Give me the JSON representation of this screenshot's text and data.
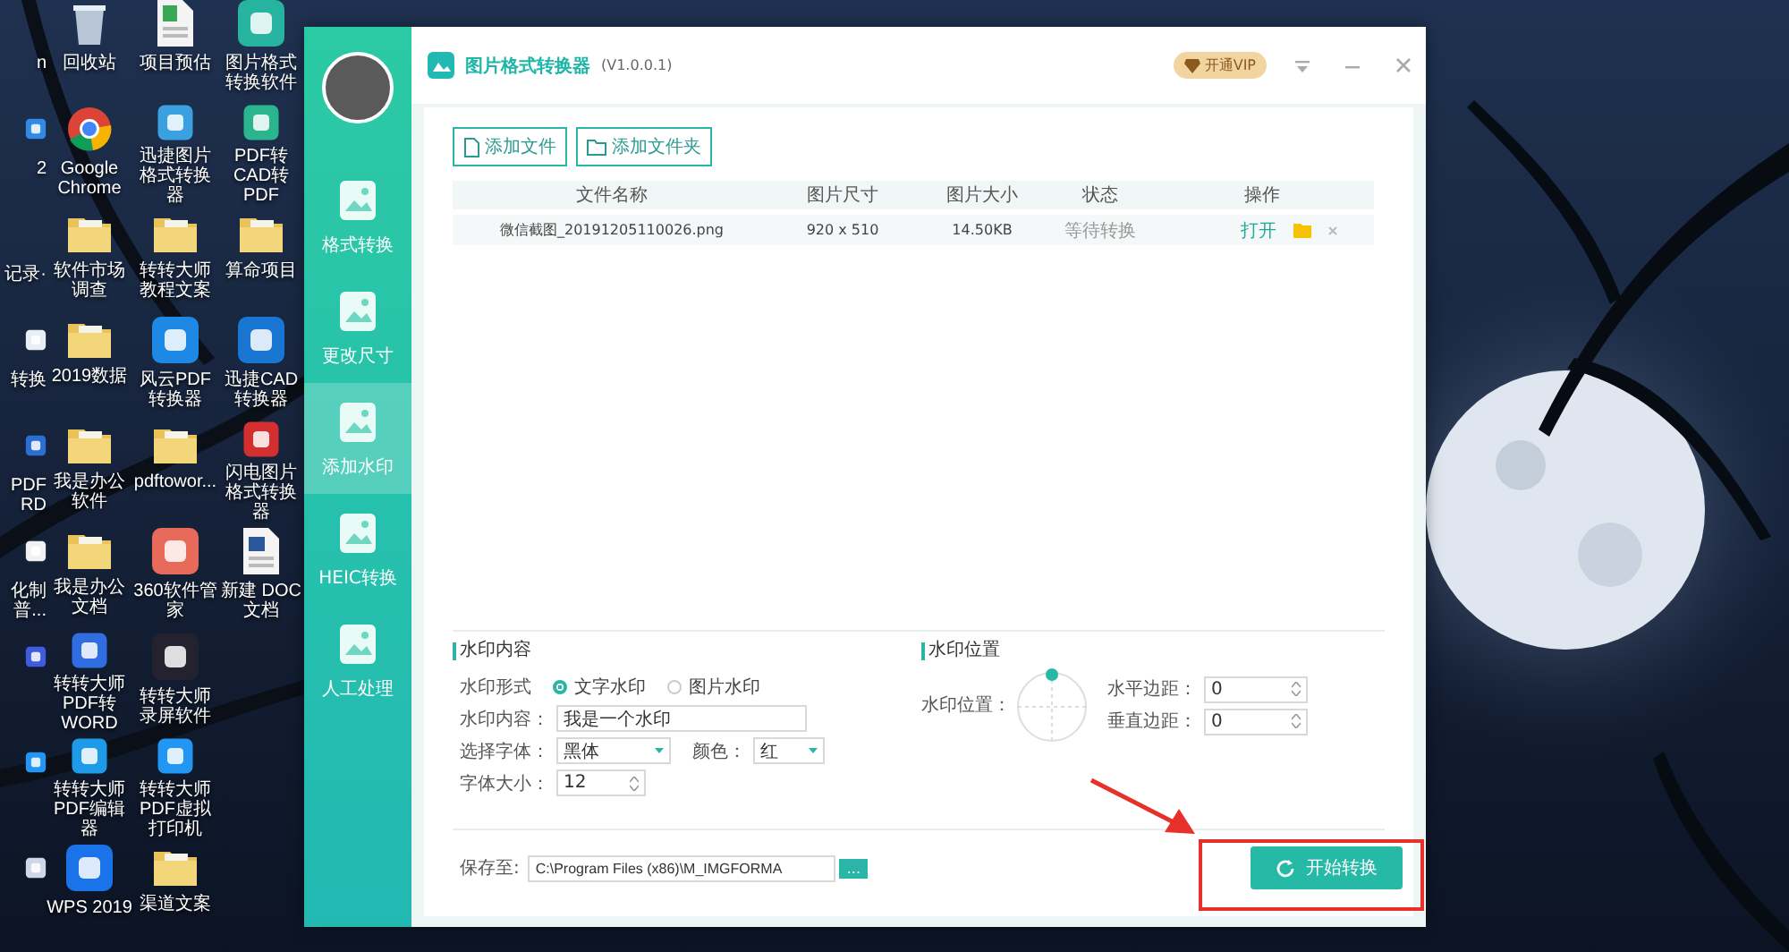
{
  "desktop": {
    "columns": [
      [
        {
          "label": "n"
        },
        {
          "kind": "app",
          "color": "#2f8ae6",
          "label": "2"
        },
        {
          "label": "记录·"
        },
        {
          "kind": "app",
          "color": "#e8eef5",
          "label": "转换"
        },
        {
          "kind": "app",
          "color": "#2a6fd6",
          "label": "PDF RD"
        },
        {
          "kind": "app",
          "color": "#f2f2f2",
          "label": "化制普..."
        },
        {
          "kind": "app",
          "color": "#3f5ce0"
        },
        {
          "kind": "app",
          "color": "#2196f3"
        },
        {
          "kind": "app",
          "color": "#cfd8e6"
        }
      ],
      [
        {
          "kind": "recycle",
          "label": "回收站"
        },
        {
          "kind": "browser",
          "label": "Google Chrome"
        },
        {
          "kind": "folder",
          "label": "软件市场调查"
        },
        {
          "kind": "folder",
          "label": "2019数据"
        },
        {
          "kind": "folder",
          "label": "我是办公软件"
        },
        {
          "kind": "folder",
          "label": "我是办公文档"
        },
        {
          "kind": "app",
          "color": "#2f6de0",
          "label": "转转大师PDF转WORD"
        },
        {
          "kind": "app",
          "color": "#1e9be8",
          "label": "转转大师PDF编辑器"
        },
        {
          "kind": "app",
          "color": "#1a73e8",
          "label": "WPS 2019"
        }
      ],
      [
        {
          "kind": "sheet",
          "label": "项目预估"
        },
        {
          "kind": "app",
          "color": "#3aa0e0",
          "label": "迅捷图片格式转换器"
        },
        {
          "kind": "folder",
          "label": "转转大师教程文案"
        },
        {
          "kind": "app",
          "color": "#1e88e5",
          "label": "风云PDF转换器"
        },
        {
          "kind": "folder",
          "label": "pdftowor..."
        },
        {
          "kind": "app",
          "color": "#e86a5a",
          "label": "360软件管家"
        },
        {
          "kind": "app",
          "color": "#23222e",
          "label": "转转大师录屏软件"
        },
        {
          "kind": "app",
          "color": "#2196f3",
          "label": "转转大师PDF虚拟打印机"
        },
        {
          "kind": "folder",
          "label": "渠道文案"
        }
      ],
      [
        {
          "kind": "app",
          "color": "#26b3a0",
          "label": "图片格式转换软件"
        },
        {
          "kind": "app",
          "color": "#2bb58e",
          "label": "PDF转CAD转PDF"
        },
        {
          "kind": "folder",
          "label": "算命项目"
        },
        {
          "kind": "app",
          "color": "#1976d2",
          "label": "迅捷CAD转换器"
        },
        {
          "kind": "app",
          "color": "#d32f2f",
          "label": "闪电图片格式转换器"
        },
        {
          "kind": "doc",
          "label": "新建 DOC 文档"
        }
      ]
    ]
  },
  "window": {
    "title": "图片格式转换器",
    "version": "(V1.0.0.1)",
    "vip_button": "开通VIP"
  },
  "sidebar": {
    "items": [
      {
        "label": "格式转换",
        "selected": false
      },
      {
        "label": "更改尺寸",
        "selected": false
      },
      {
        "label": "添加水印",
        "selected": true
      },
      {
        "label": "HEIC转换",
        "selected": false
      },
      {
        "label": "人工处理",
        "selected": false
      }
    ]
  },
  "toolbar": {
    "buttons": [
      "添加文件",
      "添加文件夹"
    ]
  },
  "table": {
    "columns": [
      "文件名称",
      "图片尺寸",
      "图片大小",
      "状态",
      "操作"
    ],
    "rows": [
      {
        "cells": [
          "微信截图_20191205110026.png",
          "920 x 510",
          "14.50KB",
          "等待转换"
        ],
        "action": "打开"
      }
    ]
  },
  "watermark_content": {
    "title": "水印内容",
    "form_label": "水印形式",
    "options": [
      {
        "label": "文字水印",
        "selected": true
      },
      {
        "label": "图片水印",
        "selected": false
      }
    ],
    "content_label": "水印内容：",
    "content_value": "我是一个水印",
    "font_label": "选择字体：",
    "font_value": "黑体",
    "color_label": "颜色：",
    "color_value": "红",
    "size_label": "字体大小：",
    "size_value": "12"
  },
  "watermark_position": {
    "title": "水印位置",
    "position_label": "水印位置：",
    "h_label": "水平边距：",
    "h_value": "0",
    "v_label": "垂直边距：",
    "v_value": "0"
  },
  "save": {
    "label": "保存至:",
    "path": "C:\\Program Files (x86)\\M_IMGFORMA",
    "browse": "..."
  },
  "start_button": "开始转换",
  "annotations": {
    "arrow": true,
    "frame": true
  }
}
